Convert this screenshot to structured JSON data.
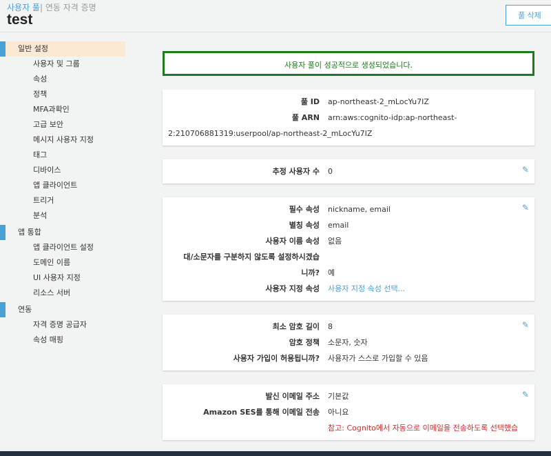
{
  "header": {
    "crumb_active": "사용자 풀",
    "crumb_other": "연동 자격 증명",
    "title": "test",
    "delete_button": "풀 삭제"
  },
  "sidebar": [
    {
      "section": "일반 설정",
      "active": true,
      "items": [
        "사용자 및 그룹",
        "속성",
        "정책",
        "MFA과확인",
        "고급 보안",
        "메시지 사용자 지정",
        "태그",
        "디바이스",
        "앱 클라이언트",
        "트리거",
        "분석"
      ]
    },
    {
      "section": "앱 통합",
      "items": [
        "앱 클라이언트 설정",
        "도메인 이름",
        "UI 사용자 지정",
        "리소스 서버"
      ]
    },
    {
      "section": "연동",
      "items": [
        "자격 증명 공급자",
        "속성 매핑"
      ]
    }
  ],
  "success": "사용자 풀이 성공적으로 생성되었습니다.",
  "cards": [
    [
      {
        "k": "풀 ID",
        "v": "ap-northeast-2_mLocYu7IZ"
      },
      {
        "k": "풀 ARN",
        "v": "arn:aws:cognito-idp:ap-northeast-"
      },
      {
        "k": "",
        "v": "2:210706881319:userpool/ap-northeast-2_mLocYu7IZ",
        "full": true
      }
    ],
    [
      {
        "k": "추정 사용자 수",
        "v": "0"
      }
    ],
    [
      {
        "k": "필수 속성",
        "v": "nickname, email"
      },
      {
        "k": "별칭 속성",
        "v": "email"
      },
      {
        "k": "사용자 이름 속성",
        "v": "없음"
      },
      {
        "k": "대/소문자를 구분하지 않도록 설정하시겠습",
        "v": ""
      },
      {
        "k": "니까?",
        "v": "예"
      },
      {
        "k": "사용자 지정 속성",
        "v": "사용자 지정 속성 선택...",
        "cls": "link"
      }
    ],
    [
      {
        "k": "최소 암호 길이",
        "v": "8"
      },
      {
        "k": "암호 정책",
        "v": "소문자, 숫자"
      },
      {
        "k": "사용자 가입이 허용됩니까?",
        "v": "사용자가 스스로 가입할 수 있음"
      }
    ],
    [
      {
        "k": "발신 이메일 주소",
        "v": "기본값"
      },
      {
        "k": "Amazon SES를 통해 이메일 전송",
        "v": "아니요"
      },
      {
        "k": "",
        "v": "참고: Cognito에서 자동으로 이메일을 전송하도록 선택했습",
        "cls": "red"
      }
    ]
  ]
}
